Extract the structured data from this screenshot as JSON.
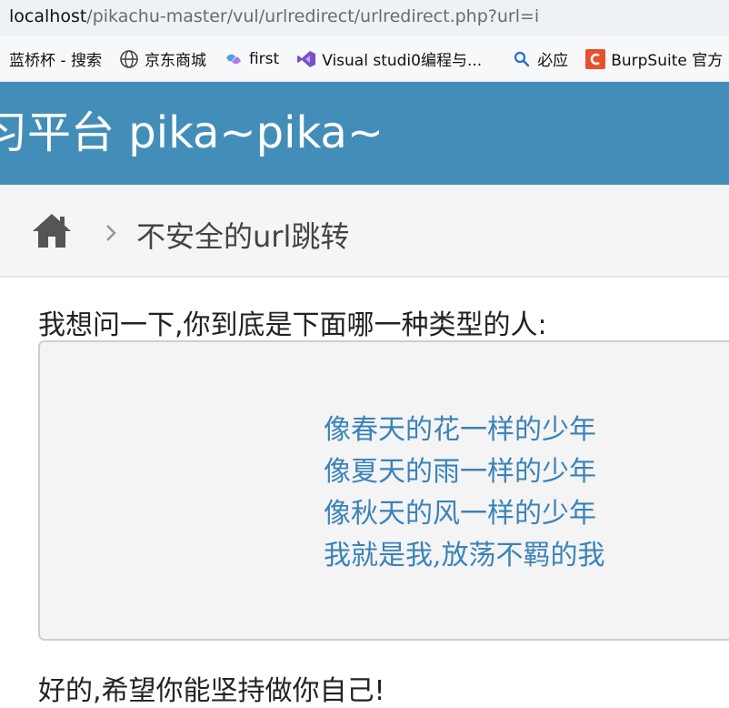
{
  "browser": {
    "url_host": "localhost",
    "url_path": "/pikachu-master/vul/urlredirect/urlredirect.php?url=i"
  },
  "bookmarks": [
    {
      "label": "蓝桥杯 - 搜索",
      "icon": "none"
    },
    {
      "label": "京东商城",
      "icon": "globe-icon"
    },
    {
      "label": "first",
      "icon": "copilot-icon"
    },
    {
      "label": "Visual studi0编程与...",
      "icon": "visual-studio-icon"
    },
    {
      "label": "必应",
      "icon": "search-icon"
    },
    {
      "label": "BurpSuite 官方",
      "icon": "c-logo-icon"
    }
  ],
  "header": {
    "title": "习平台 pika~pika~"
  },
  "breadcrumb": {
    "current": "不安全的url跳转"
  },
  "main": {
    "question": "我想问一下,你到底是下面哪一种类型的人:",
    "choices": [
      "像春天的花一样的少年",
      "像夏天的雨一样的少年",
      "像秋天的风一样的少年",
      "我就是我,放荡不羁的我"
    ],
    "footer": "好的,希望你能坚持做你自己!"
  },
  "colors": {
    "header_bg": "#438eb9",
    "link": "#3a83b8",
    "breadcrumb_bg": "#f5f5f5"
  }
}
